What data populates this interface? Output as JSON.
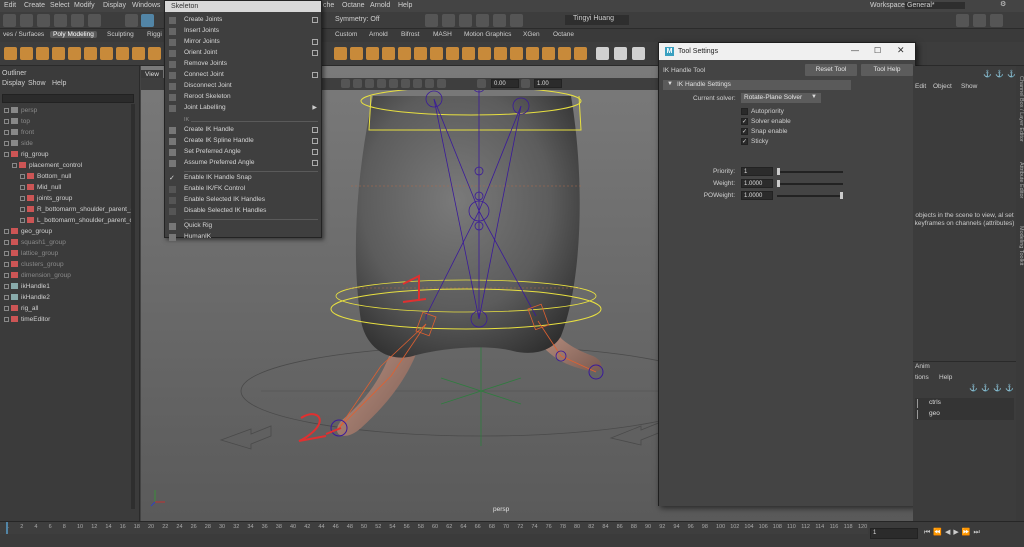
{
  "menubar": [
    "Edit",
    "Create",
    "Select",
    "Modify",
    "Display",
    "Windows"
  ],
  "menubar_right": [
    "che",
    "Octane",
    "Arnold",
    "Help"
  ],
  "workspace": {
    "label": "Workspace:",
    "value": "General*"
  },
  "statusline": {
    "symmetry": "Symmetry: Off",
    "user": "Tingyi Huang"
  },
  "shelf_tabs": [
    "ves / Surfaces",
    "Poly Modeling",
    "Sculpting",
    "Riggi",
    "Custom",
    "Arnold",
    "Bifrost",
    "MASH",
    "Motion Graphics",
    "XGen",
    "Octane"
  ],
  "shelf_active": "Poly Modeling",
  "outliner": {
    "title": "Outliner",
    "menu": [
      "Display",
      "Show",
      "Help"
    ],
    "items": [
      {
        "label": "persp",
        "dim": true,
        "indent": 0
      },
      {
        "label": "top",
        "dim": true,
        "indent": 0
      },
      {
        "label": "front",
        "dim": true,
        "indent": 0
      },
      {
        "label": "side",
        "dim": true,
        "indent": 0
      },
      {
        "label": "rig_group",
        "dim": false,
        "indent": 0
      },
      {
        "label": "placement_control",
        "dim": false,
        "indent": 1
      },
      {
        "label": "Bottom_null",
        "dim": false,
        "indent": 2
      },
      {
        "label": "Mid_null",
        "dim": false,
        "indent": 2
      },
      {
        "label": "joints_group",
        "dim": false,
        "indent": 2
      },
      {
        "label": "R_bottomarm_shoulder_parent_c",
        "dim": false,
        "indent": 2
      },
      {
        "label": "L_bottomarm_shoulder_parent_c",
        "dim": false,
        "indent": 2
      },
      {
        "label": "geo_group",
        "dim": false,
        "indent": 0
      },
      {
        "label": "squash1_group",
        "dim": true,
        "indent": 0
      },
      {
        "label": "lattice_group",
        "dim": true,
        "indent": 0
      },
      {
        "label": "clusters_group",
        "dim": true,
        "indent": 0
      },
      {
        "label": "dimension_group",
        "dim": true,
        "indent": 0
      },
      {
        "label": "ikHandle1",
        "dim": false,
        "indent": 0
      },
      {
        "label": "ikHandle2",
        "dim": false,
        "indent": 0
      },
      {
        "label": "rig_all",
        "dim": false,
        "indent": 0
      },
      {
        "label": "timeEditor",
        "dim": false,
        "indent": 0
      }
    ]
  },
  "viewport": {
    "menu_label": "View",
    "camera": "persp",
    "field1": "0.00",
    "field2": "1.00",
    "annotations": [
      "1",
      "2"
    ]
  },
  "skeleton_menu": {
    "title": "Skeleton",
    "section_ik": "IK",
    "items": [
      {
        "label": "Create Joints",
        "option": true
      },
      {
        "label": "Insert Joints",
        "option": false
      },
      {
        "label": "Mirror Joints",
        "option": true
      },
      {
        "label": "Orient Joint",
        "option": true
      },
      {
        "label": "Remove Joints",
        "option": false
      },
      {
        "label": "Connect Joint",
        "option": true
      },
      {
        "label": "Disconnect Joint",
        "option": false
      },
      {
        "label": "Reroot Skeleton",
        "option": false
      },
      {
        "label": "Joint Labelling",
        "submenu": true
      }
    ],
    "ik_items": [
      {
        "label": "Create IK Handle",
        "option": true
      },
      {
        "label": "Create IK Spline Handle",
        "option": true
      },
      {
        "label": "Set Preferred Angle",
        "option": true
      },
      {
        "label": "Assume Preferred Angle",
        "option": true
      }
    ],
    "toggle_items": [
      {
        "label": "Enable IK Handle Snap",
        "checked": true
      },
      {
        "label": "Enable IK/FK Control",
        "checked": false
      },
      {
        "label": "Enable Selected IK Handles",
        "checked": false
      },
      {
        "label": "Disable Selected IK Handles",
        "checked": false
      }
    ],
    "bottom_items": [
      "Quick Rig",
      "HumanIK"
    ]
  },
  "tool_settings": {
    "window_title": "Tool Settings",
    "tool_name": "IK Handle Tool",
    "reset_label": "Reset Tool",
    "help_label": "Tool Help",
    "section": "IK Handle Settings",
    "solver_label": "Current solver:",
    "solver_value": "Rotate-Plane Solver",
    "checkboxes": [
      {
        "label": "Autopriority",
        "checked": false
      },
      {
        "label": "Solver enable",
        "checked": true
      },
      {
        "label": "Snap enable",
        "checked": true
      },
      {
        "label": "Sticky",
        "checked": true
      }
    ],
    "fields": [
      {
        "label": "Priority:",
        "value": "1",
        "level": 0.0
      },
      {
        "label": "Weight:",
        "value": "1.0000",
        "level": 0.0
      },
      {
        "label": "POWeight:",
        "value": "1.0000",
        "level": 1.0
      }
    ]
  },
  "channel_box": {
    "menu": [
      "Edit",
      "Object",
      "Show"
    ],
    "message": "objects in the scene to view, al set keyframes on channels (attributes)"
  },
  "layer_editor": {
    "title": "Anim",
    "menu": [
      "tions",
      "Help"
    ],
    "layers": [
      "ctrls",
      "geo"
    ]
  },
  "side_tabs": [
    "Channel Box / Layer Editor",
    "Attribute Editor",
    "Modeling Toolkit"
  ],
  "timeline": {
    "ticks": [
      "1",
      "2",
      "4",
      "6",
      "8",
      "10",
      "12",
      "14",
      "16",
      "18",
      "20",
      "22",
      "24",
      "26",
      "28",
      "30",
      "32",
      "34",
      "36",
      "38",
      "40",
      "42",
      "44",
      "46",
      "48",
      "50",
      "52",
      "54",
      "56",
      "58",
      "60",
      "62",
      "64",
      "66",
      "68",
      "70",
      "72",
      "74",
      "76",
      "78",
      "80",
      "82",
      "84",
      "86",
      "88",
      "90",
      "92",
      "94",
      "96",
      "98",
      "100",
      "102",
      "104",
      "106",
      "108",
      "110",
      "112",
      "114",
      "116",
      "118",
      "120"
    ],
    "current_frame": "1"
  },
  "colors": {
    "accent": "#5285a6",
    "menu_header": "#d8d8d8",
    "yellow_ctrl": "#e8e040",
    "joint": "#3a1a9a",
    "ik_orange": "#e06030",
    "annotation_red": "#e03030"
  }
}
